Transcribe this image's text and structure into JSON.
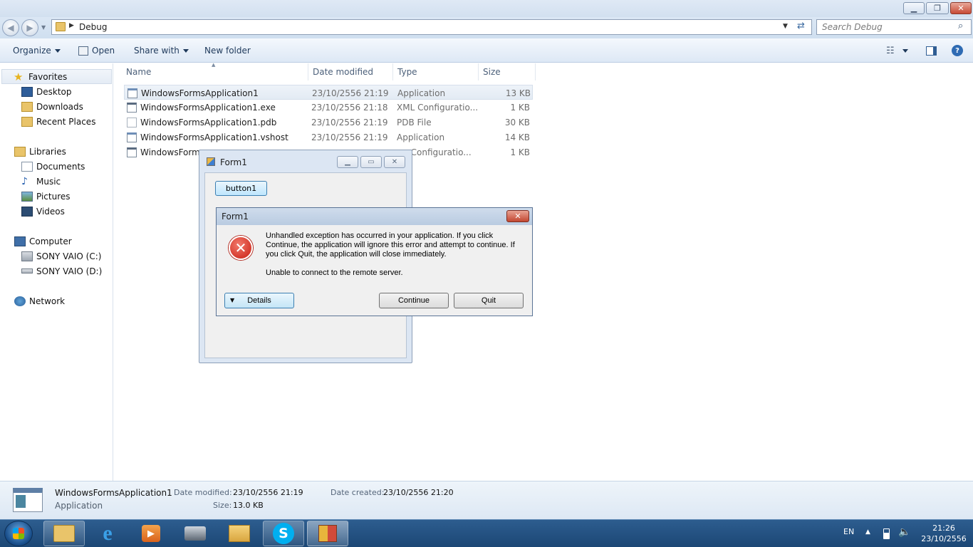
{
  "address": {
    "path": "Debug",
    "search_placeholder": "Search Debug"
  },
  "toolbar": {
    "organize": "Organize",
    "open": "Open",
    "share_with": "Share with",
    "new_folder": "New folder"
  },
  "nav": {
    "favorites": "Favorites",
    "favorites_items": [
      "Desktop",
      "Downloads",
      "Recent Places"
    ],
    "libraries": "Libraries",
    "libraries_items": [
      "Documents",
      "Music",
      "Pictures",
      "Videos"
    ],
    "computer": "Computer",
    "computer_items": [
      "SONY VAIO (C:)",
      "SONY VAIO (D:)"
    ],
    "network": "Network"
  },
  "columns": {
    "name": "Name",
    "date": "Date modified",
    "type": "Type",
    "size": "Size"
  },
  "files": [
    {
      "name": "WindowsFormsApplication1",
      "date": "23/10/2556 21:19",
      "type": "Application",
      "size": "13 KB"
    },
    {
      "name": "WindowsFormsApplication1.exe",
      "date": "23/10/2556 21:18",
      "type": "XML Configuratio...",
      "size": "1 KB"
    },
    {
      "name": "WindowsFormsApplication1.pdb",
      "date": "23/10/2556 21:19",
      "type": "PDB File",
      "size": "30 KB"
    },
    {
      "name": "WindowsFormsApplication1.vshost",
      "date": "23/10/2556 21:19",
      "type": "Application",
      "size": "14 KB"
    },
    {
      "name": "WindowsForms",
      "date": "",
      "type": ". Configuratio...",
      "size": "1 KB"
    }
  ],
  "details": {
    "name": "WindowsFormsApplication1",
    "kind": "Application",
    "modified_label": "Date modified:",
    "modified_value": "23/10/2556 21:19",
    "created_label": "Date created:",
    "created_value": "23/10/2556 21:20",
    "size_label": "Size:",
    "size_value": "13.0 KB"
  },
  "form1": {
    "title": "Form1",
    "button": "button1"
  },
  "dialog": {
    "title": "Form1",
    "message_1": "Unhandled exception has occurred in your application. If you click",
    "message_2": "Continue, the application will ignore this error and attempt to continue. If",
    "message_3": "you click Quit, the application will close immediately.",
    "error": "Unable to connect to the remote server.",
    "details": "Details",
    "continue": "Continue",
    "quit": "Quit"
  },
  "tray": {
    "language": "EN",
    "time": "21:26",
    "date": "23/10/2556"
  }
}
